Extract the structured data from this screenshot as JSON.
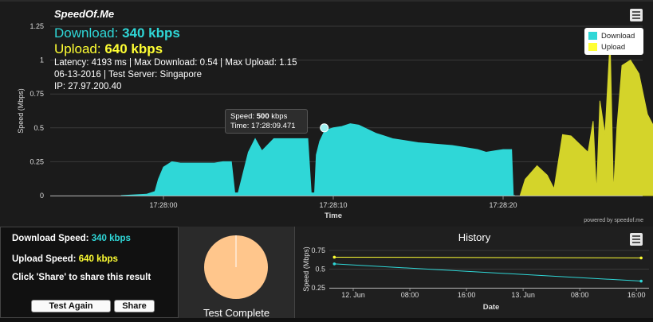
{
  "app": {
    "title": "SpeedOf.Me"
  },
  "overlay": {
    "download_label": "Download:",
    "download_value": "340 kbps",
    "upload_label": "Upload:",
    "upload_value": "640 kbps",
    "stats_line": "Latency: 4193 ms | Max Download: 0.54 | Max Upload: 1.15",
    "date_line": "06-13-2016 | Test Server: Singapore",
    "ip_line": "IP: 27.97.200.40"
  },
  "tooltip": {
    "speed_label": "Speed:",
    "speed_value": "500",
    "speed_unit": "kbps",
    "time_label": "Time:",
    "time_value": "17:28:09.471"
  },
  "credits": "powered by speedof.me",
  "colors": {
    "download": "#2fd7d7",
    "upload": "#d4d42a",
    "upload_text": "#ffff33",
    "pie": "#ffc68c"
  },
  "results": {
    "download_label": "Download Speed:",
    "download_value": "340 kbps",
    "upload_label": "Upload Speed:",
    "upload_value": "640 kbps",
    "share_hint": "Click 'Share' to share this result",
    "test_again_label": "Test Again",
    "share_label": "Share"
  },
  "pie": {
    "label": "Test Complete",
    "fraction": 1.0
  },
  "chart_data": [
    {
      "type": "area",
      "title": "",
      "xlabel": "Time",
      "ylabel": "Speed (Mbps)",
      "ylim": [
        0,
        1.25
      ],
      "yticks": [
        0,
        0.25,
        0.5,
        0.75,
        1,
        1.25
      ],
      "ytick_labels": [
        "0",
        "0.25",
        "0.5",
        "0.75",
        "1",
        "1.25"
      ],
      "xlim": [
        -2.5,
        21.5
      ],
      "xticks": [
        0,
        10,
        20
      ],
      "xtick_labels": [
        "17:28:00",
        "17:28:10",
        "17:28:20"
      ],
      "legend": {
        "placement": "top-right"
      },
      "highlight": {
        "x": 9.47,
        "y": 0.5
      },
      "series": [
        {
          "name": "Download",
          "x": [
            -2.5,
            -1.0,
            -0.5,
            -0.3,
            0,
            0.5,
            1,
            1.5,
            2,
            2.5,
            3,
            3.5,
            4,
            4.2,
            4.4,
            5,
            5.4,
            5.8,
            6.5,
            7,
            7.5,
            8,
            8.5,
            8.7,
            8.9,
            9.0,
            9.2,
            9.5,
            10,
            10.5,
            11,
            11.5,
            12,
            12.5,
            13,
            13.5,
            14,
            15,
            16,
            17,
            18,
            18.5,
            19,
            19.5,
            20,
            20.5,
            20.6,
            20.7
          ],
          "y": [
            0,
            0.01,
            0.03,
            0.12,
            0.21,
            0.25,
            0.24,
            0.24,
            0.24,
            0.24,
            0.24,
            0.25,
            0.25,
            0.02,
            0.02,
            0.32,
            0.42,
            0.33,
            0.42,
            0.42,
            0.42,
            0.42,
            0.42,
            0.02,
            0.02,
            0.3,
            0.4,
            0.48,
            0.5,
            0.51,
            0.53,
            0.52,
            0.49,
            0.46,
            0.44,
            0.42,
            0.41,
            0.39,
            0.38,
            0.37,
            0.35,
            0.34,
            0.32,
            0.33,
            0.34,
            0.34,
            0.0,
            0.0
          ]
        },
        {
          "name": "Upload",
          "x": [
            21.0,
            21.3,
            22.0,
            22.6,
            23.0,
            23.5,
            24.0,
            24.5,
            25.0,
            25.3,
            25.5,
            25.7,
            26.0,
            26.3,
            26.5,
            26.7,
            27.0,
            27.5,
            28.0,
            28.5,
            29.0,
            29.5,
            30.0,
            30.5,
            31.0,
            31.5,
            32.0,
            32.5,
            33.0,
            33.2,
            33.4
          ],
          "y": [
            0.0,
            0.12,
            0.22,
            0.15,
            0.05,
            0.45,
            0.44,
            0.38,
            0.32,
            0.55,
            0.02,
            0.7,
            0.45,
            1.15,
            0.02,
            0.5,
            0.96,
            1.0,
            0.9,
            0.6,
            0.48,
            0.55,
            0.55,
            0.56,
            0.57,
            0.58,
            0.6,
            0.62,
            0.64,
            0.65,
            0.64
          ]
        }
      ]
    },
    {
      "type": "line",
      "title": "History",
      "xlabel": "Date",
      "ylabel": "Speed (Mbps)",
      "ylim": [
        0.25,
        0.75
      ],
      "yticks": [
        0.25,
        0.5,
        0.75
      ],
      "ytick_labels": [
        "0.25",
        "0.5",
        "0.75"
      ],
      "xlim": [
        -4,
        61
      ],
      "xticks": [
        0,
        12,
        24,
        36,
        48,
        60
      ],
      "xtick_labels": [
        "12. Jun",
        "08:00",
        "16:00",
        "13. Jun",
        "08:00",
        "16:00"
      ],
      "series": [
        {
          "name": "Upload",
          "x": [
            -4,
            61
          ],
          "y": [
            0.66,
            0.65
          ]
        },
        {
          "name": "Download",
          "x": [
            -4,
            61
          ],
          "y": [
            0.57,
            0.34
          ]
        }
      ]
    }
  ]
}
